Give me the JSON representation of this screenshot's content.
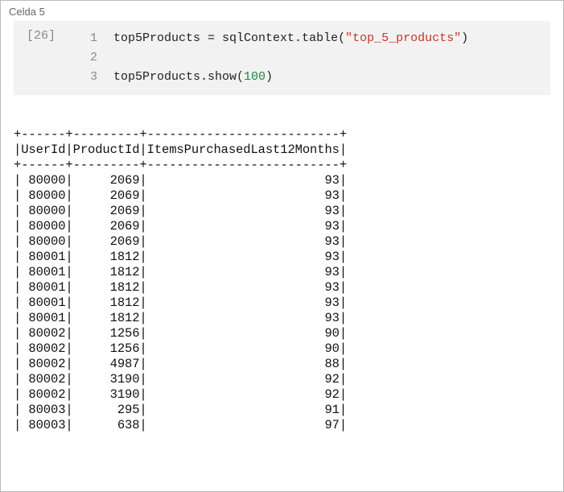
{
  "cell": {
    "header": "Celda 5",
    "execCount": "[26]",
    "lineNumbers": [
      "1",
      "2",
      "3"
    ],
    "code": {
      "l1_var": "top5Products",
      "l1_eq": " = ",
      "l1_call1": "sqlContext.table(",
      "l1_str": "\"top_5_products\"",
      "l1_call2": ")",
      "l3_obj": "top5Products.show(",
      "l3_num": "100",
      "l3_close": ")"
    }
  },
  "output": {
    "border": "+------+---------+--------------------------+",
    "header": "|UserId|ProductId|ItemsPurchasedLast12Months|",
    "rows": [
      "| 80000|     2069|                        93|",
      "| 80000|     2069|                        93|",
      "| 80000|     2069|                        93|",
      "| 80000|     2069|                        93|",
      "| 80000|     2069|                        93|",
      "| 80001|     1812|                        93|",
      "| 80001|     1812|                        93|",
      "| 80001|     1812|                        93|",
      "| 80001|     1812|                        93|",
      "| 80001|     1812|                        93|",
      "| 80002|     1256|                        90|",
      "| 80002|     1256|                        90|",
      "| 80002|     4987|                        88|",
      "| 80002|     3190|                        92|",
      "| 80002|     3190|                        92|",
      "| 80003|      295|                        91|",
      "| 80003|      638|                        97|"
    ]
  },
  "chart_data": {
    "type": "table",
    "title": "top_5_products (first rows from top5Products.show(100))",
    "columns": [
      "UserId",
      "ProductId",
      "ItemsPurchasedLast12Months"
    ],
    "rows": [
      [
        80000,
        2069,
        93
      ],
      [
        80000,
        2069,
        93
      ],
      [
        80000,
        2069,
        93
      ],
      [
        80000,
        2069,
        93
      ],
      [
        80000,
        2069,
        93
      ],
      [
        80001,
        1812,
        93
      ],
      [
        80001,
        1812,
        93
      ],
      [
        80001,
        1812,
        93
      ],
      [
        80001,
        1812,
        93
      ],
      [
        80001,
        1812,
        93
      ],
      [
        80002,
        1256,
        90
      ],
      [
        80002,
        1256,
        90
      ],
      [
        80002,
        4987,
        88
      ],
      [
        80002,
        3190,
        92
      ],
      [
        80002,
        3190,
        92
      ],
      [
        80003,
        295,
        91
      ],
      [
        80003,
        638,
        97
      ]
    ]
  }
}
